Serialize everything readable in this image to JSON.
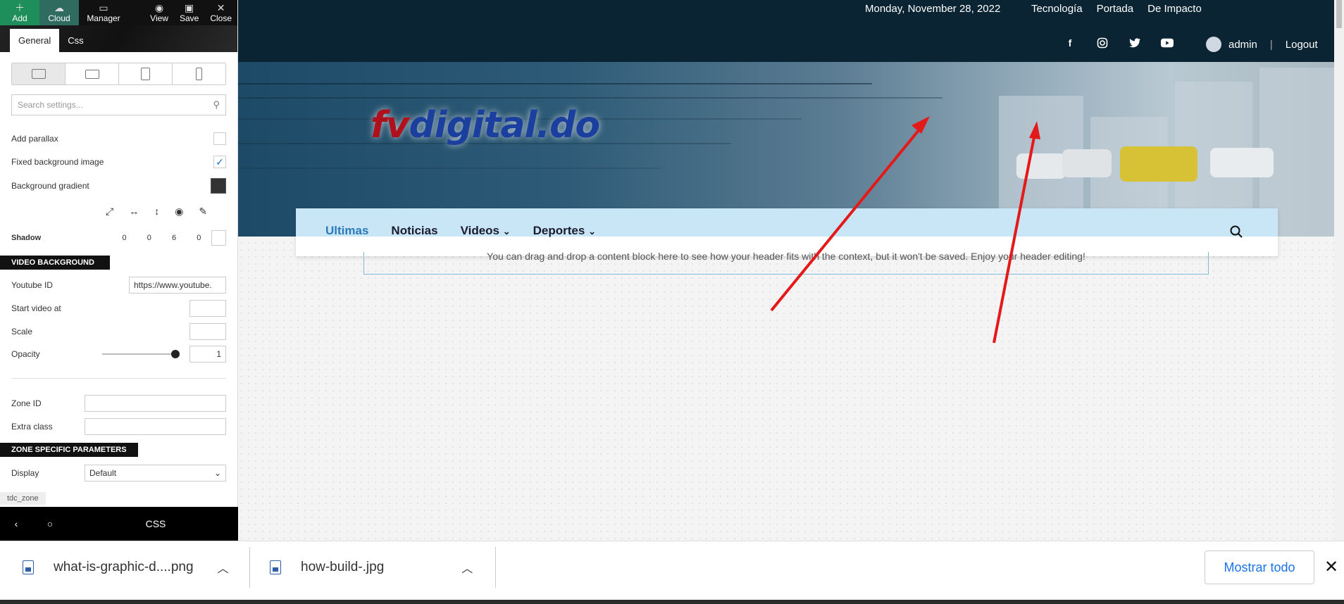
{
  "toolbar": {
    "add": "Add",
    "cloud": "Cloud",
    "manager": "Manager",
    "view": "View",
    "save": "Save",
    "close": "Close"
  },
  "tabs": [
    "General",
    "Css"
  ],
  "search": {
    "placeholder": "Search settings..."
  },
  "settings": {
    "add_parallax": "Add parallax",
    "fixed_bg": "Fixed background image",
    "fixed_bg_checked": true,
    "bg_gradient": "Background gradient",
    "shadow_label": "Shadow",
    "shadow_values": [
      "0",
      "0",
      "6",
      "0"
    ]
  },
  "video_section": {
    "title": "VIDEO BACKGROUND",
    "youtube_label": "Youtube ID",
    "youtube_value": "https://www.youtube.",
    "start_label": "Start video at",
    "scale_label": "Scale",
    "opacity_label": "Opacity",
    "opacity_value": "1"
  },
  "zone": {
    "zone_id_label": "Zone ID",
    "extra_class_label": "Extra class"
  },
  "zone_params": {
    "title": "ZONE SPECIFIC PARAMETERS",
    "display_label": "Display",
    "display_value": "Default"
  },
  "tdc_zone": "tdc_zone",
  "bottom_nav": {
    "css": "CSS"
  },
  "site": {
    "date": "Monday, November 28, 2022",
    "top_links": [
      "Tecnología",
      "Portada",
      "De Impacto"
    ],
    "user": "admin",
    "logout": "Logout",
    "logo_fv": "fv",
    "logo_rest": "digital.do",
    "menu": [
      "Ultimas",
      "Noticias",
      "Videos",
      "Deportes"
    ],
    "dropzone_text": "You can drag and drop a content block here to see how your header fits with the context, but it won't be saved. Enjoy your header editing!"
  },
  "downloads": {
    "items": [
      "what-is-graphic-d....png",
      "how-build-.jpg"
    ],
    "show_all": "Mostrar todo"
  },
  "colors": {
    "accent": "#2e7ab8",
    "header_bg": "#0a2433",
    "arrow": "#e41a1a"
  }
}
